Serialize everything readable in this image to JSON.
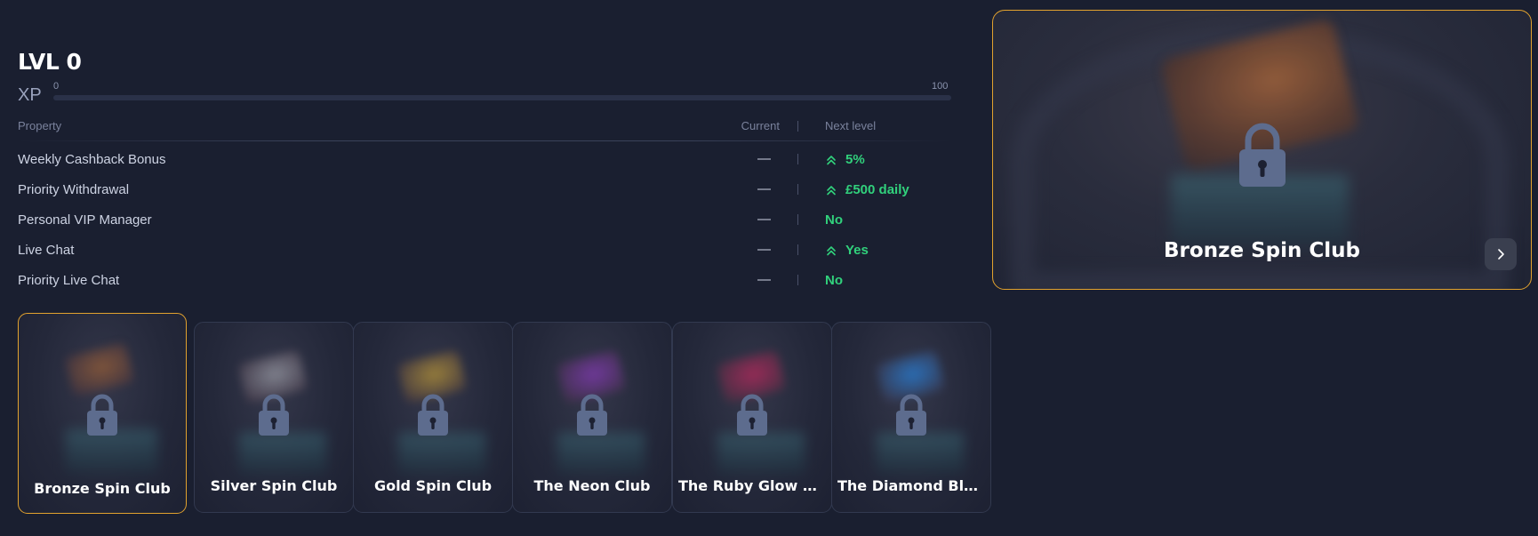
{
  "level": {
    "title": "LVL 0",
    "xp_label": "XP",
    "xp_min": "0",
    "xp_max": "100",
    "xp_progress_fraction": 0
  },
  "table": {
    "headers": {
      "property": "Property",
      "current": "Current",
      "next_level": "Next level"
    },
    "rows": [
      {
        "property": "Weekly Cashback Bonus",
        "current": "—",
        "next": "5%",
        "up": true
      },
      {
        "property": "Priority Withdrawal",
        "current": "—",
        "next": "£500 daily",
        "up": true
      },
      {
        "property": "Personal VIP Manager",
        "current": "—",
        "next": "No",
        "up": false
      },
      {
        "property": "Live Chat",
        "current": "—",
        "next": "Yes",
        "up": true
      },
      {
        "property": "Priority Live Chat",
        "current": "—",
        "next": "No",
        "up": false
      }
    ]
  },
  "feature": {
    "title": "Bronze Spin Club",
    "icons": {
      "lock": "lock-icon",
      "next": "chevron-right-icon"
    },
    "card_color": "#9a5f3a"
  },
  "tiers": [
    {
      "name": "Bronze Spin Club",
      "color": "#8b5a3a",
      "active": true
    },
    {
      "name": "Silver Spin Club",
      "color": "#8d8f9a",
      "active": false
    },
    {
      "name": "Gold Spin Club",
      "color": "#a88a3a",
      "active": false
    },
    {
      "name": "The Neon Club",
      "color": "#7a3aa8",
      "active": false
    },
    {
      "name": "The Ruby Glow Cl...",
      "color": "#a82a5a",
      "active": false
    },
    {
      "name": "The Diamond Bla...",
      "color": "#2a78c8",
      "active": false
    }
  ],
  "colors": {
    "accent": "#e2a22e",
    "positive": "#31d17c",
    "lock": "#5d6c8e"
  }
}
